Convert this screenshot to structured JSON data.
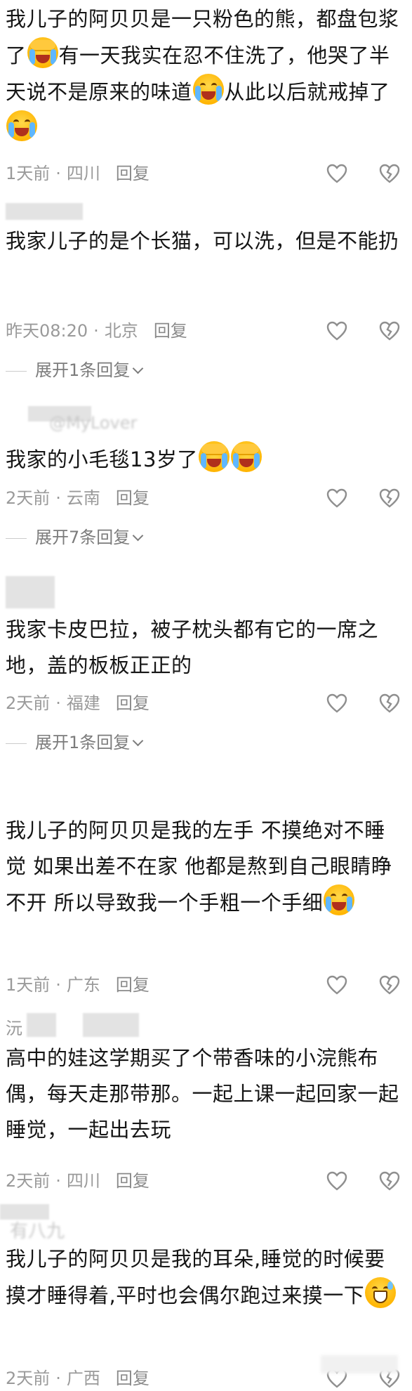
{
  "comments": [
    {
      "username": "",
      "content_parts": [
        "我儿子的阿贝贝是一只粉色的熊，都盘包浆了",
        "有一天我实在忍不住洗了，他哭了半天说不是原来的味道",
        "从此以后就戒掉了"
      ],
      "time": "1天前",
      "location": "四川",
      "reply_label": "回复"
    },
    {
      "username": "",
      "content": "我家儿子的是个长猫，可以洗，但是不能扔",
      "time": "昨天08:20",
      "location": "北京",
      "reply_label": "回复",
      "expand_label": "展开1条回复"
    },
    {
      "username": "@MyLover",
      "content": "我家的小毛毯13岁了",
      "time": "2天前",
      "location": "云南",
      "reply_label": "回复",
      "expand_label": "展开7条回复"
    },
    {
      "username": "",
      "content": "我家卡皮巴拉，被子枕头都有它的一席之地，盖的板板正正的",
      "time": "2天前",
      "location": "福建",
      "reply_label": "回复",
      "expand_label": "展开1条回复"
    },
    {
      "username": "",
      "content_parts": [
        "我儿子的阿贝贝是我的左手  不摸绝对不睡觉  如果出差不在家 他都是熬到自己眼睛睁不开   所以导致我一个手粗一个手细"
      ],
      "time": "1天前",
      "location": "广东",
      "reply_label": "回复"
    },
    {
      "username": "沅",
      "content": "高中的娃这学期买了个带香味的小浣熊布偶，每天走那带那。一起上课一起回家一起睡觉，一起出去玩",
      "time": "2天前",
      "location": "四川",
      "reply_label": "回复"
    },
    {
      "username": "有八九",
      "content_parts": [
        "我儿子的阿贝贝是我的耳朵,睡觉的时候要摸才睡得着,平时也会偶尔跑过来摸一下"
      ],
      "time": "2天前",
      "location": "广西",
      "reply_label": "回复"
    }
  ],
  "icons": {
    "like": "heart-icon",
    "dislike": "broken-heart-icon",
    "emoji_cry": "crying-face-emoji",
    "emoji_sob": "sobbing-face-emoji",
    "emoji_sweat": "grinning-sweat-emoji"
  },
  "colors": {
    "text": "#151515",
    "meta": "#9a9a9a",
    "icon": "#8f8f8f",
    "expand": "#7c7c7c"
  }
}
